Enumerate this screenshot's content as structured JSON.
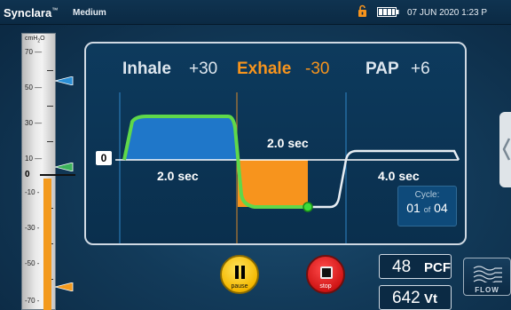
{
  "topbar": {
    "brand": "Synclara",
    "trademark": "™",
    "mode": "Medium",
    "datetime": "07 JUN 2020  1:23 P"
  },
  "gauge": {
    "unit_base": "cmH",
    "unit_sub": "2",
    "unit_tail": "O",
    "tick_labels": [
      "70 —",
      "50 —",
      "30 —",
      "10 —",
      "0",
      "-10 -",
      "-30 -",
      "-50 -",
      "-70 -"
    ]
  },
  "header": {
    "inhale_label": "Inhale",
    "inhale_value": "+30",
    "exhale_label": "Exhale",
    "exhale_value": "-30",
    "pap_label": "PAP",
    "pap_value": "+6"
  },
  "waveform": {
    "baseline": "0",
    "inhale_duration": "2.0 sec",
    "exhale_duration": "2.0 sec",
    "pause_duration": "4.0 sec"
  },
  "cycle": {
    "title": "Cycle:",
    "current": "01",
    "of": "of",
    "total": "04"
  },
  "controls": {
    "pause_label": "pause",
    "stop_label": "stop"
  },
  "readouts": {
    "pcf_value": "48",
    "pcf_unit": "PCF",
    "vt_value": "642",
    "vt_unit": "Vt"
  },
  "flow_button": {
    "label": "FLOW"
  },
  "colors": {
    "inhale": "#1f77c9",
    "exhale": "#f7941d",
    "curve": "#5fd84a",
    "marker_blue": "#2a8fd6",
    "marker_green": "#3cb35a",
    "marker_orange": "#f39a1e"
  }
}
